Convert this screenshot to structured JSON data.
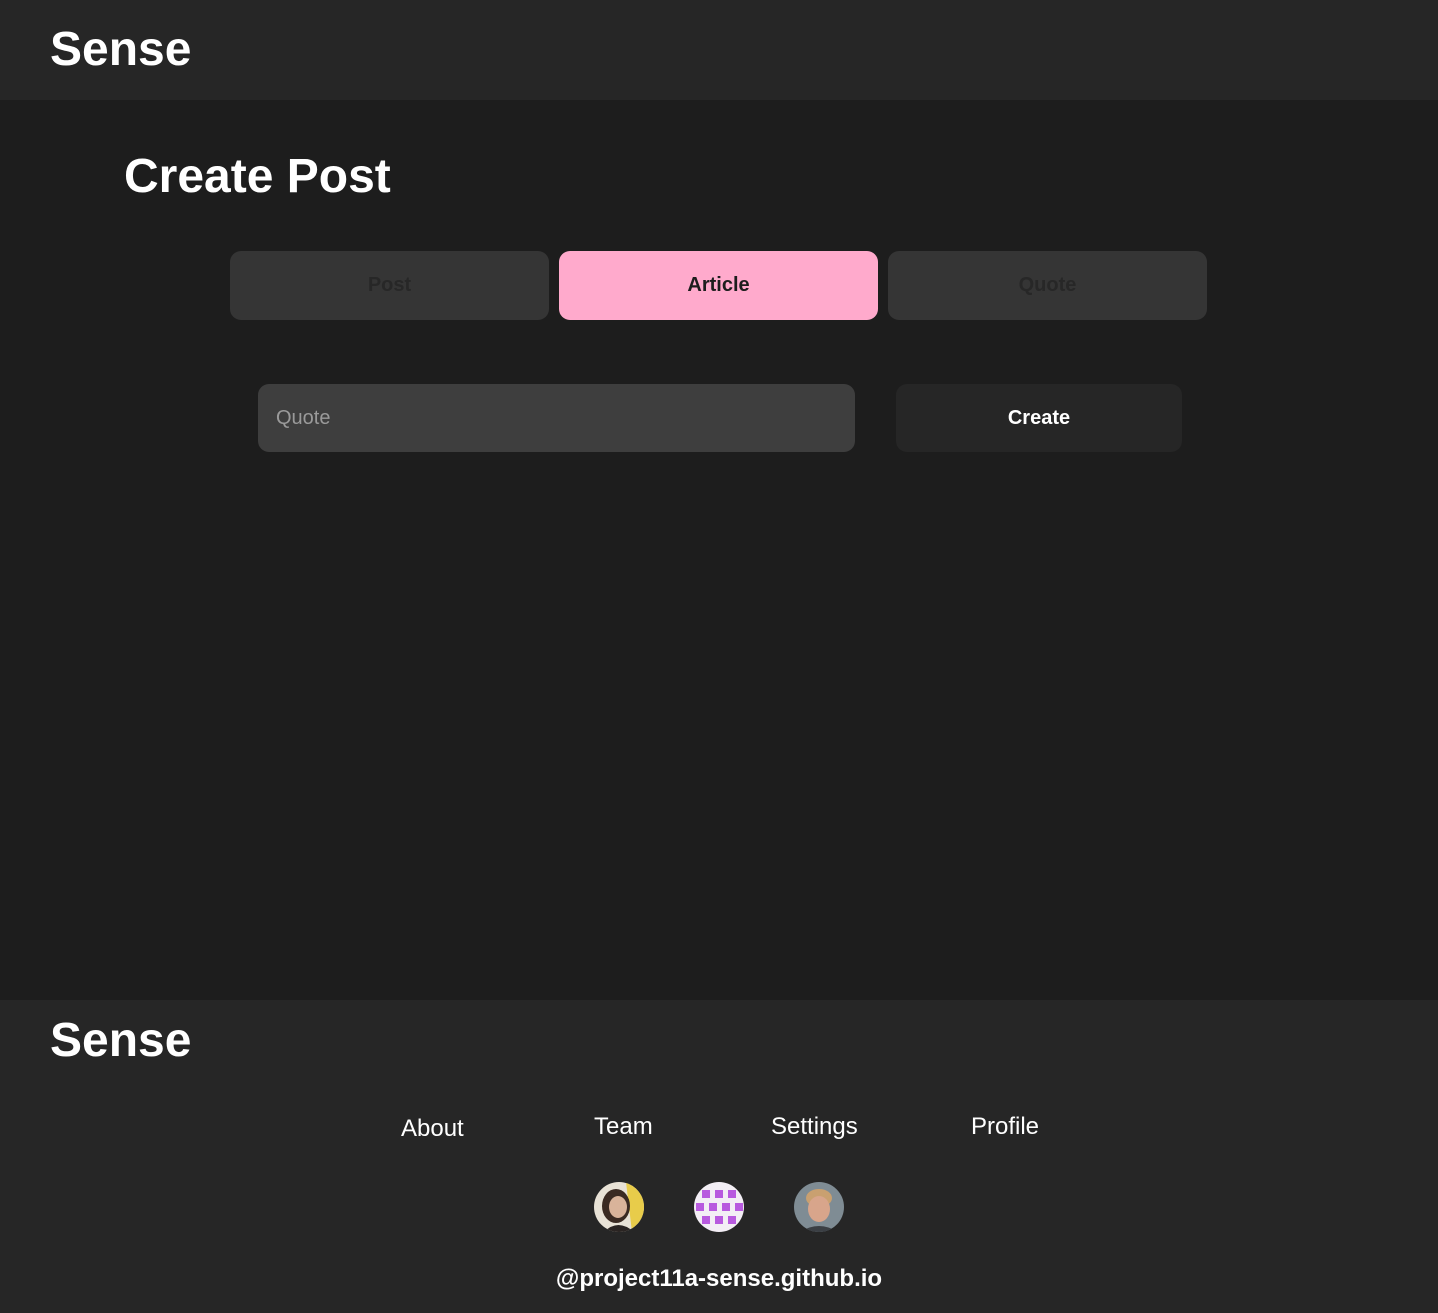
{
  "header": {
    "brand": "Sense"
  },
  "main": {
    "title": "Create Post",
    "tabs": [
      {
        "label": "Post",
        "active": false
      },
      {
        "label": "Article",
        "active": true
      },
      {
        "label": "Quote",
        "active": false
      }
    ],
    "quote_input": {
      "value": "",
      "placeholder": "Quote"
    },
    "create_label": "Create"
  },
  "footer": {
    "brand": "Sense",
    "links": [
      "About",
      "Team",
      "Settings",
      "Profile"
    ],
    "avatars": [
      "avatar-photo-icon",
      "avatar-pattern-icon",
      "avatar-photo-icon"
    ],
    "handle": "@project11a-sense.github.io"
  },
  "colors": {
    "background": "#1d1d1d",
    "bar": "#262626",
    "tab_inactive": "#353535",
    "tab_active": "#ffaacc",
    "input_bg": "#3e3e3e",
    "text": "#ffffff"
  }
}
